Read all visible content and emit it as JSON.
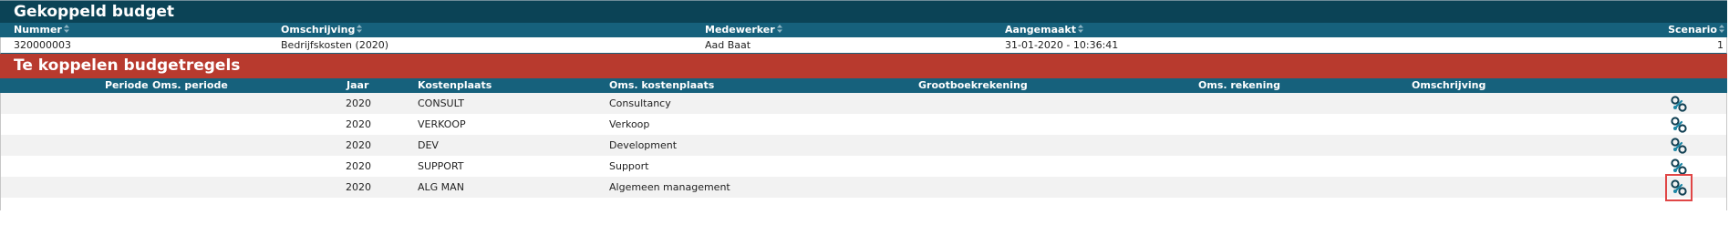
{
  "gekoppeld": {
    "title": "Gekoppeld budget",
    "headers": {
      "nummer": "Nummer",
      "omschrijving": "Omschrijving",
      "medewerker": "Medewerker",
      "aangemaakt": "Aangemaakt",
      "scenario": "Scenario"
    },
    "row": {
      "nummer": "320000003",
      "omschrijving": "Bedrijfskosten (2020)",
      "medewerker": "Aad Baat",
      "aangemaakt": "31-01-2020 - 10:36:41",
      "scenario": "1"
    }
  },
  "koppelen": {
    "title": "Te koppelen budgetregels",
    "headers": {
      "periode": "Periode",
      "oms_periode": "Oms. periode",
      "jaar": "Jaar",
      "kostenplaats": "Kostenplaats",
      "oms_kostenplaats": "Oms. kostenplaats",
      "grootboekrekening": "Grootboekrekening",
      "oms_rekening": "Oms. rekening",
      "omschrijving": "Omschrijving"
    },
    "rows": [
      {
        "jaar": "2020",
        "kostenplaats": "CONSULT",
        "oms_kostenplaats": "Consultancy"
      },
      {
        "jaar": "2020",
        "kostenplaats": "VERKOOP",
        "oms_kostenplaats": "Verkoop"
      },
      {
        "jaar": "2020",
        "kostenplaats": "DEV",
        "oms_kostenplaats": "Development"
      },
      {
        "jaar": "2020",
        "kostenplaats": "SUPPORT",
        "oms_kostenplaats": "Support"
      },
      {
        "jaar": "2020",
        "kostenplaats": "ALG MAN",
        "oms_kostenplaats": "Algemeen management"
      }
    ]
  },
  "icons": {
    "sort": "sort-icon",
    "link": "link-icon"
  },
  "colors": {
    "title_dark": "#0b4356",
    "header_teal": "#16617c",
    "title_red": "#b83a2e",
    "highlight": "#e04646"
  }
}
